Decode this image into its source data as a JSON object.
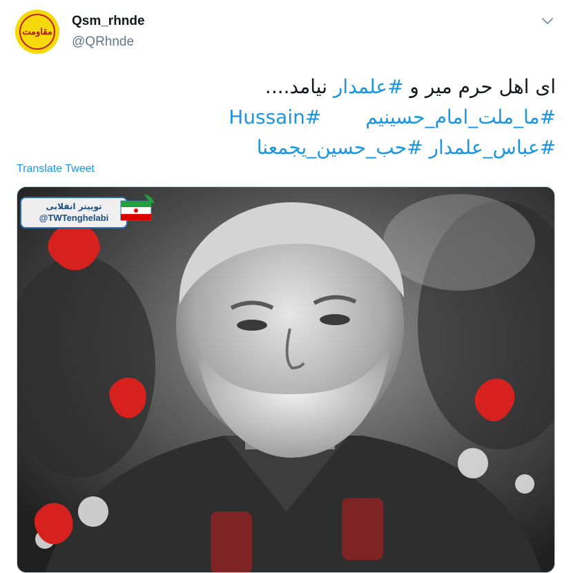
{
  "user": {
    "display_name": "Qsm_rhnde",
    "handle": "@QRhnde",
    "avatar_text": "مقاومت"
  },
  "tweet": {
    "line1_plain_a": "ای اهل حرم میر و ",
    "line1_hashtag": "#علمدار",
    "line1_plain_b": " نیامد....",
    "line2_hashtag_a": "#ما_ملت_امام_حسینیم",
    "line2_hashtag_b": "#Hussain",
    "line3_hashtag_a": "#عباس_علمدار",
    "line3_hashtag_b": "#حب_حسین_یجمعنا"
  },
  "translate_label": "Translate Tweet",
  "media": {
    "watermark_title": "توییتر انقلابی",
    "watermark_handle": "@TWTenghelabi"
  },
  "colors": {
    "link": "#1b95e0",
    "secondary": "#657786",
    "avatar_bg": "#f5d90a"
  }
}
